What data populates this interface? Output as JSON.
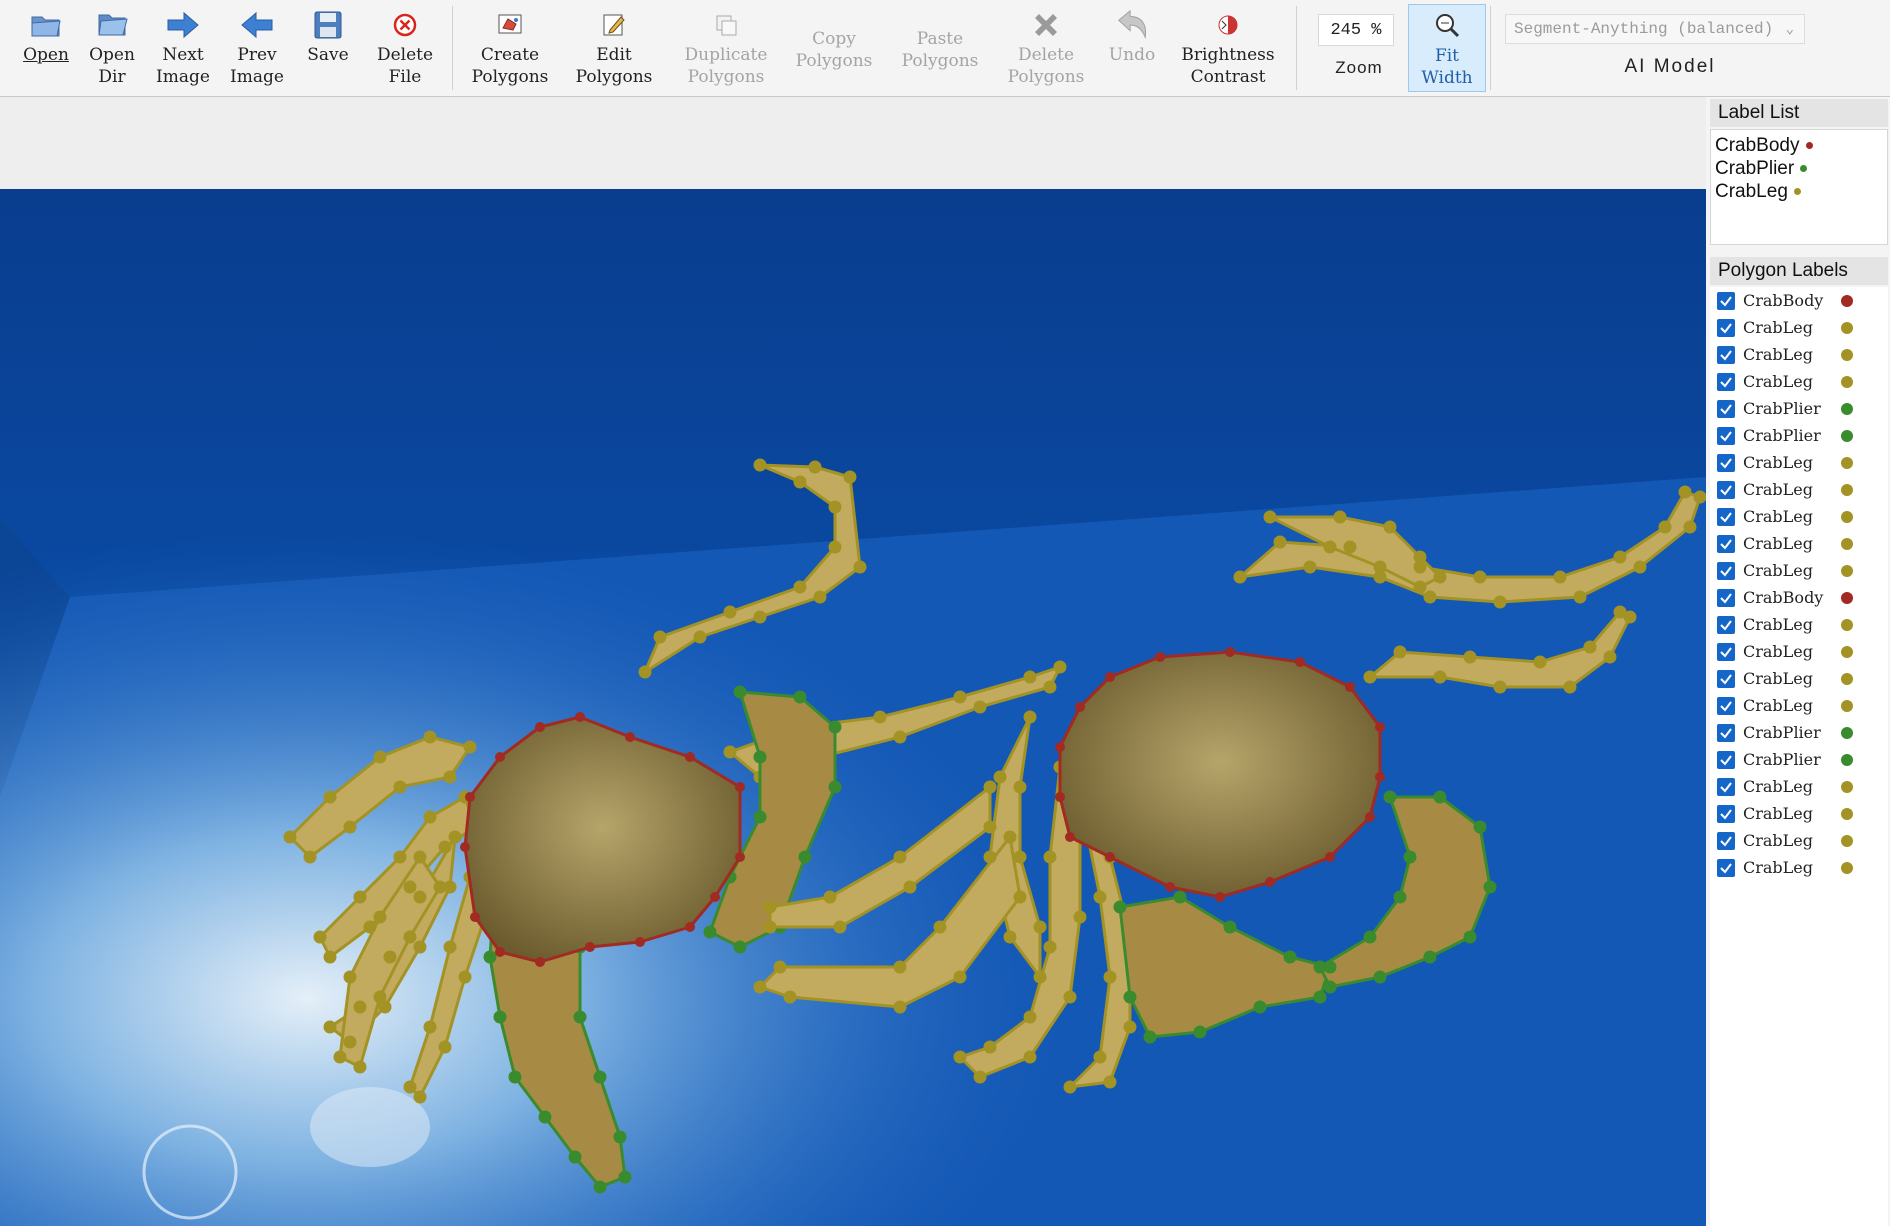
{
  "toolbar": {
    "buttons": [
      {
        "id": "open",
        "label": "Open",
        "icon": "folder-icon",
        "disabled": false
      },
      {
        "id": "open-dir",
        "label": "Open\nDir",
        "icon": "folder-open-icon",
        "disabled": false
      },
      {
        "id": "next-image",
        "label": "Next\nImage",
        "icon": "arrow-right-icon",
        "disabled": false
      },
      {
        "id": "prev-image",
        "label": "Prev\nImage",
        "icon": "arrow-left-icon",
        "disabled": false
      },
      {
        "id": "save",
        "label": "Save",
        "icon": "floppy-icon",
        "disabled": false
      },
      {
        "id": "delete-file",
        "label": "Delete\nFile",
        "icon": "delete-circle-icon",
        "disabled": false
      },
      {
        "id": "create-polygons",
        "label": "Create\nPolygons",
        "icon": "create-polygon-icon",
        "disabled": false
      },
      {
        "id": "edit-polygons",
        "label": "Edit\nPolygons",
        "icon": "edit-icon",
        "disabled": false
      },
      {
        "id": "duplicate-polygons",
        "label": "Duplicate\nPolygons",
        "icon": "duplicate-icon",
        "disabled": true
      },
      {
        "id": "copy-polygons",
        "label": "Copy\nPolygons",
        "icon": "copy-icon",
        "disabled": true
      },
      {
        "id": "paste-polygons",
        "label": "Paste\nPolygons",
        "icon": "paste-icon",
        "disabled": true
      },
      {
        "id": "delete-polygons",
        "label": "Delete\nPolygons",
        "icon": "x-icon",
        "disabled": true
      },
      {
        "id": "undo",
        "label": "Undo",
        "icon": "undo-icon",
        "disabled": true
      },
      {
        "id": "brightness-contrast",
        "label": "Brightness\nContrast",
        "icon": "brightness-icon",
        "disabled": false
      },
      {
        "id": "fit-width",
        "label": "Fit\nWidth",
        "icon": "zoom-fit-icon",
        "disabled": false,
        "active": true
      }
    ],
    "zoom_value": "245 %",
    "zoom_label": "Zoom",
    "model_select": "Segment-Anything (balanced)",
    "ai_model_label": "AI Model"
  },
  "label_list": {
    "title": "Label List",
    "items": [
      {
        "name": "CrabBody",
        "color": "#a12a22"
      },
      {
        "name": "CrabPlier",
        "color": "#3a8b2d"
      },
      {
        "name": "CrabLeg",
        "color": "#a39224"
      }
    ]
  },
  "polygon_labels": {
    "title": "Polygon Labels",
    "items": [
      {
        "name": "CrabBody",
        "color": "#a12a22"
      },
      {
        "name": "CrabLeg",
        "color": "#a39224"
      },
      {
        "name": "CrabLeg",
        "color": "#a39224"
      },
      {
        "name": "CrabLeg",
        "color": "#a39224"
      },
      {
        "name": "CrabPlier",
        "color": "#3a8b2d"
      },
      {
        "name": "CrabPlier",
        "color": "#3a8b2d"
      },
      {
        "name": "CrabLeg",
        "color": "#a39224"
      },
      {
        "name": "CrabLeg",
        "color": "#a39224"
      },
      {
        "name": "CrabLeg",
        "color": "#a39224"
      },
      {
        "name": "CrabLeg",
        "color": "#a39224"
      },
      {
        "name": "CrabLeg",
        "color": "#a39224"
      },
      {
        "name": "CrabBody",
        "color": "#a12a22"
      },
      {
        "name": "CrabLeg",
        "color": "#a39224"
      },
      {
        "name": "CrabLeg",
        "color": "#a39224"
      },
      {
        "name": "CrabLeg",
        "color": "#a39224"
      },
      {
        "name": "CrabLeg",
        "color": "#a39224"
      },
      {
        "name": "CrabPlier",
        "color": "#3a8b2d"
      },
      {
        "name": "CrabPlier",
        "color": "#3a8b2d"
      },
      {
        "name": "CrabLeg",
        "color": "#a39224"
      },
      {
        "name": "CrabLeg",
        "color": "#a39224"
      },
      {
        "name": "CrabLeg",
        "color": "#a39224"
      },
      {
        "name": "CrabLeg",
        "color": "#a39224"
      }
    ]
  },
  "colors": {
    "crab_body": "#a12a22",
    "crab_plier": "#3a8b2d",
    "crab_leg": "#a39224",
    "check_blue": "#1467c8"
  }
}
